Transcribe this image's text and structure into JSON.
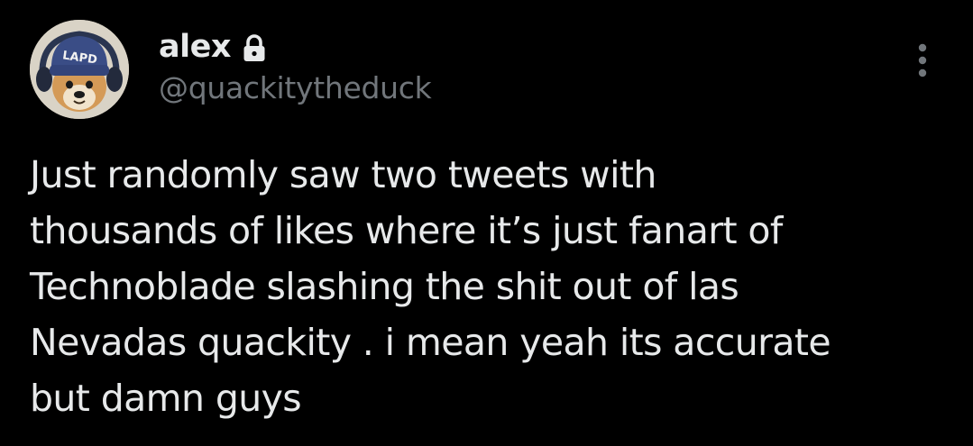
{
  "tweet": {
    "author": {
      "display_name": "alex",
      "handle": "@quackitytheduck",
      "protected_icon": "lock-icon",
      "avatar_icon": "dog-wearing-lapd-beanie-avatar"
    },
    "more_icon": "more-vertical-icon",
    "text": "Just randomly saw two tweets with\nthousands of likes where it’s just fanart of\nTechnoblade slashing the shit out of las\nNevadas quackity . i mean yeah its accurate\nbut damn guys"
  },
  "colors": {
    "background": "#000000",
    "primary_text": "#e7e9ea",
    "secondary_text": "#71767b"
  }
}
